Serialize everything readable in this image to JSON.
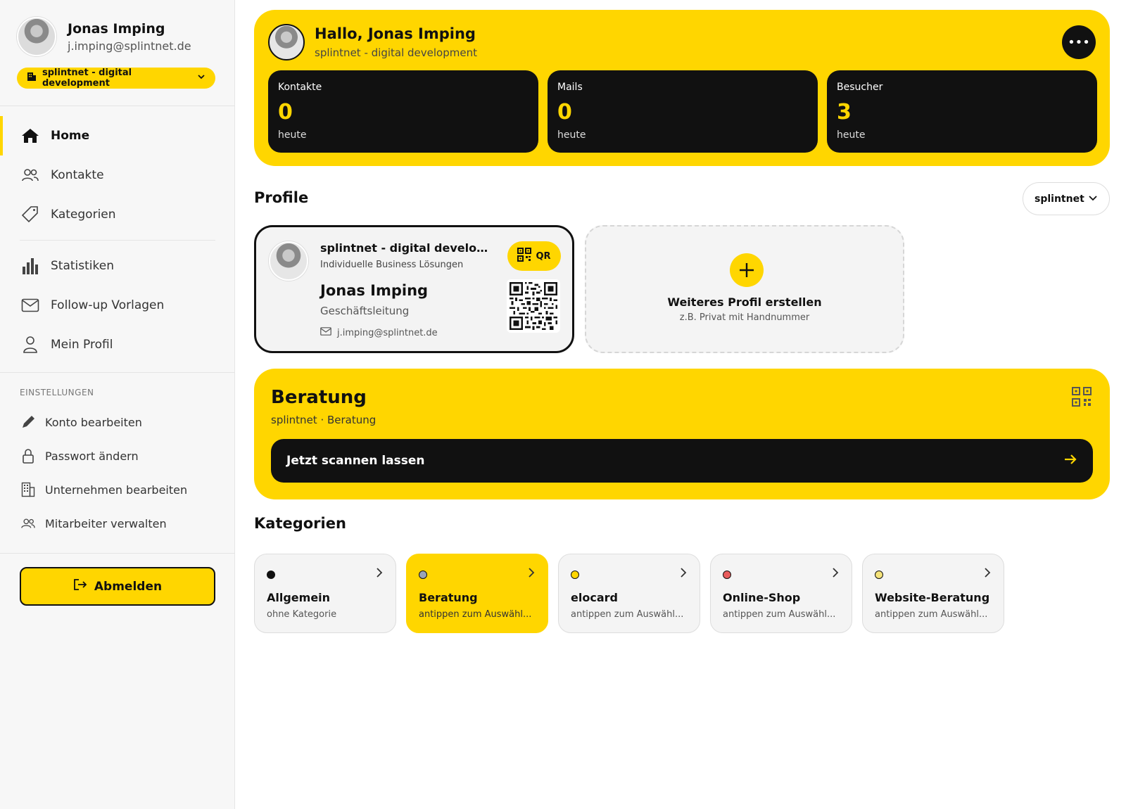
{
  "user": {
    "name": "Jonas Imping",
    "email": "j.imping@splintnet.de"
  },
  "company_selector": {
    "label": "splintnet - digital development"
  },
  "nav": {
    "items": [
      {
        "label": "Home",
        "icon": "home-icon"
      },
      {
        "label": "Kontakte",
        "icon": "users-icon"
      },
      {
        "label": "Kategorien",
        "icon": "tag-icon"
      },
      {
        "label": "Statistiken",
        "icon": "bar-chart-icon"
      },
      {
        "label": "Follow-up Vorlagen",
        "icon": "mail-icon"
      },
      {
        "label": "Mein Profil",
        "icon": "user-icon"
      }
    ],
    "active": "Home"
  },
  "settings": {
    "title": "EINSTELLUNGEN",
    "items": [
      {
        "label": "Konto bearbeiten",
        "icon": "pencil-icon"
      },
      {
        "label": "Passwort ändern",
        "icon": "lock-icon"
      },
      {
        "label": "Unternehmen bearbeiten",
        "icon": "building-icon"
      },
      {
        "label": "Mitarbeiter verwalten",
        "icon": "team-icon"
      }
    ]
  },
  "logout": {
    "label": "Abmelden"
  },
  "hero": {
    "greeting": "Hallo, Jonas Imping",
    "subtitle": "splintnet - digital development",
    "stats": [
      {
        "label": "Kontakte",
        "value": "0",
        "period": "heute"
      },
      {
        "label": "Mails",
        "value": "0",
        "period": "heute"
      },
      {
        "label": "Besucher",
        "value": "3",
        "period": "heute"
      }
    ]
  },
  "profiles": {
    "title": "Profile",
    "filter": "splintnet",
    "card": {
      "company": "splintnet - digital developm...",
      "tagline": "Individuelle Business Lösungen",
      "name": "Jonas Imping",
      "role": "Geschäftsleitung",
      "email": "j.imping@splintnet.de",
      "qr_label": "QR"
    },
    "new": {
      "title": "Weiteres Profil erstellen",
      "subtitle": "z.B. Privat mit Handnummer"
    }
  },
  "consult": {
    "title": "Beratung",
    "subtitle": "splintnet · Beratung",
    "action": "Jetzt scannen lassen"
  },
  "categories": {
    "title": "Kategorien",
    "items": [
      {
        "name": "Allgemein",
        "desc": "ohne Kategorie",
        "color": "#111111",
        "selected": false
      },
      {
        "name": "Beratung",
        "desc": "antippen zum Auswähl...",
        "color": "#9aa3b5",
        "selected": true
      },
      {
        "name": "elocard",
        "desc": "antippen zum Auswähl...",
        "color": "#ffd600",
        "selected": false
      },
      {
        "name": "Online-Shop",
        "desc": "antippen zum Auswähl...",
        "color": "#e85c5c",
        "selected": false
      },
      {
        "name": "Website-Beratung",
        "desc": "antippen zum Auswähl...",
        "color": "#f5e37a",
        "selected": false
      }
    ]
  },
  "colors": {
    "accent": "#ffd600",
    "dark": "#111111"
  }
}
